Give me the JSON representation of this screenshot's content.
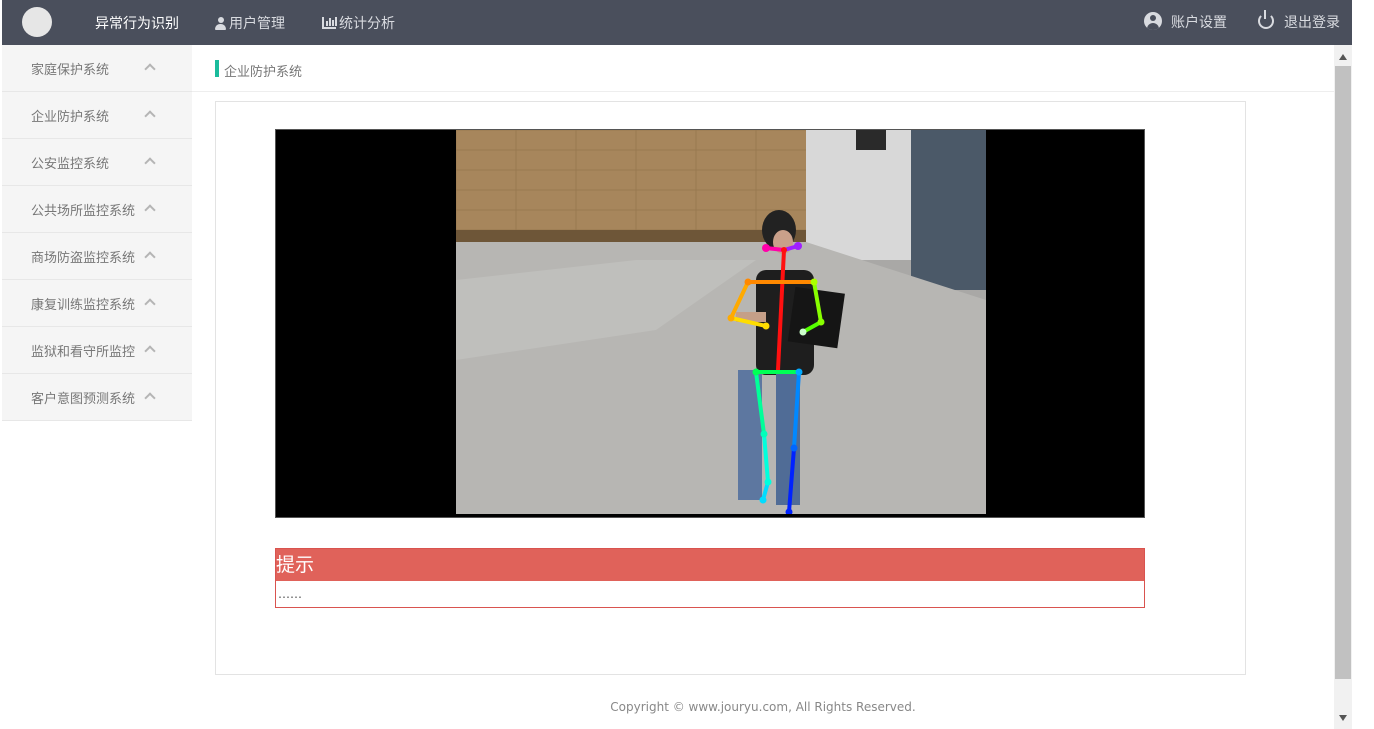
{
  "navbar": {
    "brand": "异常行为识别",
    "links": [
      {
        "label": "用户管理",
        "icon": "user-icon"
      },
      {
        "label": "统计分析",
        "icon": "bar-chart-icon"
      }
    ],
    "account_label": "账户设置",
    "logout_label": "退出登录"
  },
  "sidebar": {
    "items": [
      {
        "label": "家庭保护系统"
      },
      {
        "label": "企业防护系统"
      },
      {
        "label": "公安监控系统"
      },
      {
        "label": "公共场所监控系统"
      },
      {
        "label": "商场防盗监控系统"
      },
      {
        "label": "康复训练监控系统"
      },
      {
        "label": "监狱和看守所监控"
      },
      {
        "label": "客户意图预测系统"
      }
    ]
  },
  "breadcrumb": {
    "current": "企业防护系统"
  },
  "alert": {
    "title": "提示",
    "body": "……"
  },
  "footer": {
    "copyright": "Copyright © www.jouryu.com, All Rights Reserved."
  },
  "colors": {
    "navbar_bg": "#4a4f5c",
    "accent": "#1abc9c",
    "alert_header": "#e0625a",
    "alert_border": "#d9534f"
  }
}
